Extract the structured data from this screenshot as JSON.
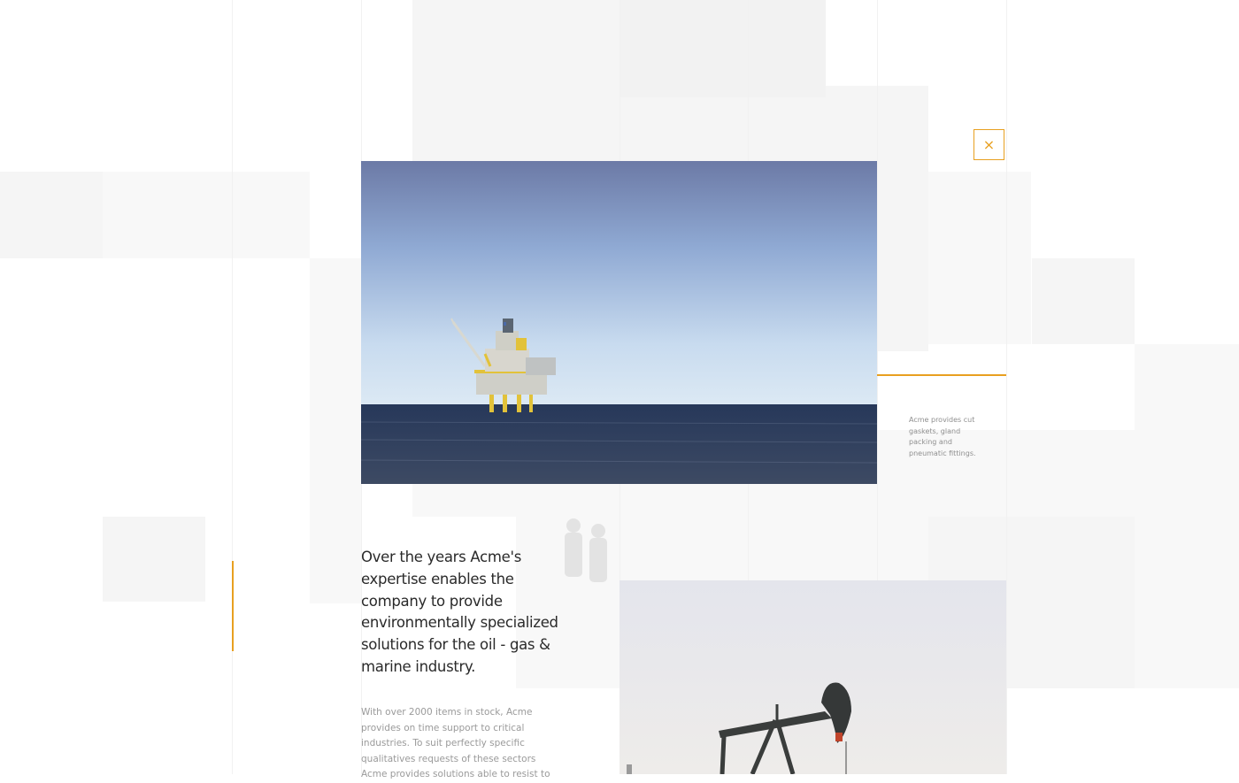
{
  "close_button": {
    "icon": "close-icon",
    "label": "×",
    "color": "#e8a020"
  },
  "hero_image": {
    "description": "offshore-oil-platform"
  },
  "side_caption": {
    "text": "Acme provides cut gaskets, gland packing and pneumatic fittings."
  },
  "intro": {
    "headline": "Over the years Acme's expertise enables the company to provide environmentally specialized solutions for the oil - gas & marine industry.",
    "body": "With over 2000 items in stock, Acme provides on time support to critical industries. To suit perfectly specific qualitatives requests of these sectors Acme provides solutions able to resist to"
  },
  "second_image": {
    "description": "oil-pumpjack"
  },
  "colors": {
    "accent": "#e8a020",
    "background": "#ffffff",
    "text_dark": "#2a2a2a",
    "text_muted": "#9a9a9a"
  }
}
